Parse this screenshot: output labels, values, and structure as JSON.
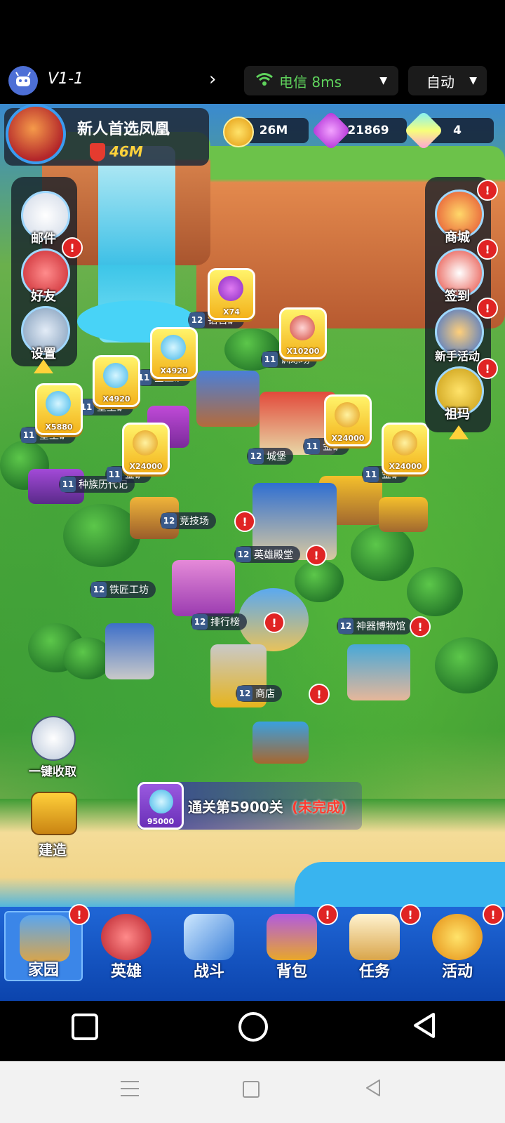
{
  "remote_bar": {
    "level": "V1-1",
    "network": "电信 8ms",
    "mode": "自动"
  },
  "player": {
    "name": "新人首选凤凰",
    "power": "46M"
  },
  "resources": {
    "gold": "26M",
    "gems": "21869",
    "crystals": "4"
  },
  "left_menu": [
    {
      "label": "邮件",
      "icon": "mail-icon",
      "alert": false
    },
    {
      "label": "好友",
      "icon": "friends-icon",
      "alert": true
    },
    {
      "label": "设置",
      "icon": "gear-icon",
      "alert": false
    }
  ],
  "right_menu": [
    {
      "label": "商城",
      "icon": "shop-gift-icon",
      "alert": true
    },
    {
      "label": "签到",
      "icon": "calendar-icon",
      "alert": true
    },
    {
      "label": "新手活动",
      "icon": "newbie-hero-icon",
      "alert": true
    },
    {
      "label": "祖玛",
      "icon": "zuma-totem-icon",
      "alert": true
    }
  ],
  "buildings": [
    {
      "level": "12",
      "name": "钻石矿"
    },
    {
      "level": "11",
      "name": "训练场"
    },
    {
      "level": "11",
      "name": "星尘矿"
    },
    {
      "level": "11",
      "name": "星尘矿"
    },
    {
      "level": "11",
      "name": "星尘矿"
    },
    {
      "level": "11",
      "name": "种族历代记"
    },
    {
      "level": "11",
      "name": "金矿"
    },
    {
      "level": "12",
      "name": "城堡"
    },
    {
      "level": "11",
      "name": "金矿"
    },
    {
      "level": "11",
      "name": "金矿"
    },
    {
      "level": "12",
      "name": "竞技场"
    },
    {
      "level": "12",
      "name": "英雄殿堂"
    },
    {
      "level": "12",
      "name": "铁匠工坊"
    },
    {
      "level": "12",
      "name": "排行榜"
    },
    {
      "level": "12",
      "name": "神器博物馆"
    },
    {
      "level": "12",
      "name": "商店"
    }
  ],
  "rewards": [
    {
      "amount": "X74",
      "type": "diamond"
    },
    {
      "amount": "X10200",
      "type": "potion"
    },
    {
      "amount": "X4920",
      "type": "stardust"
    },
    {
      "amount": "X4920",
      "type": "stardust"
    },
    {
      "amount": "X5880",
      "type": "stardust"
    },
    {
      "amount": "X24000",
      "type": "gold"
    },
    {
      "amount": "X24000",
      "type": "gold"
    },
    {
      "amount": "X24000",
      "type": "gold"
    }
  ],
  "actions": {
    "collect_all": "一键收取",
    "build": "建造"
  },
  "stage_banner": {
    "reward_amount": "95000",
    "text": "通关第5900关",
    "status": "(未完成)"
  },
  "tabs": [
    {
      "label": "家园",
      "icon": "home-icon",
      "alert": true,
      "active": true
    },
    {
      "label": "英雄",
      "icon": "hero-icon",
      "alert": false,
      "active": false
    },
    {
      "label": "战斗",
      "icon": "crossed-swords-icon",
      "alert": false,
      "active": false
    },
    {
      "label": "背包",
      "icon": "backpack-icon",
      "alert": true,
      "active": false
    },
    {
      "label": "任务",
      "icon": "quest-scroll-icon",
      "alert": true,
      "active": false
    },
    {
      "label": "活动",
      "icon": "event-crown-icon",
      "alert": true,
      "active": false
    }
  ],
  "colors": {
    "gold": "#f3b21b",
    "alert": "#e02424",
    "tab_bar": "#1f66d6",
    "incomplete": "#ff3b2f",
    "wifi_green": "#5fd35c"
  }
}
